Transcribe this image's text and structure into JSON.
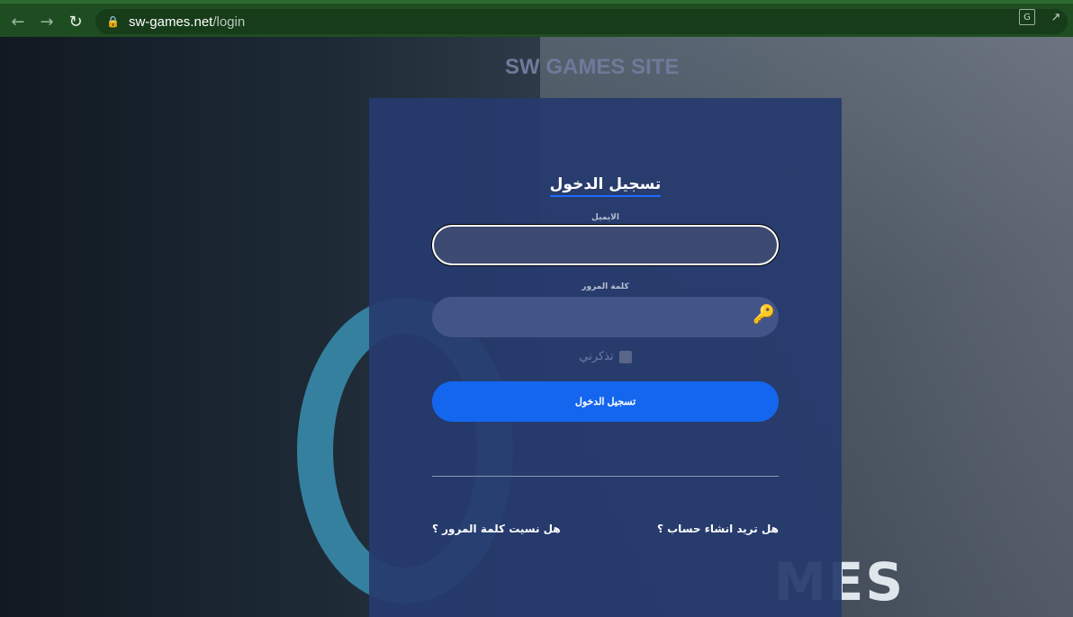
{
  "browser": {
    "url_host": "sw-games.net",
    "url_path": "/login"
  },
  "site": {
    "title": "SW GAMES SITE",
    "background_logo_text": "MES"
  },
  "login": {
    "heading": "تسجيل الدخول",
    "email_label": "الايميل",
    "email_value": "",
    "password_label": "كلمة المرور",
    "password_value": "",
    "remember_label": "تذكرني",
    "submit_label": "تسجيل الدخول",
    "register_link": "هل تريد انشاء حساب ؟",
    "forgot_link": "هل نسيت كلمة المرور ؟"
  },
  "colors": {
    "card_bg": "#263a6e",
    "accent": "#1566ee"
  }
}
